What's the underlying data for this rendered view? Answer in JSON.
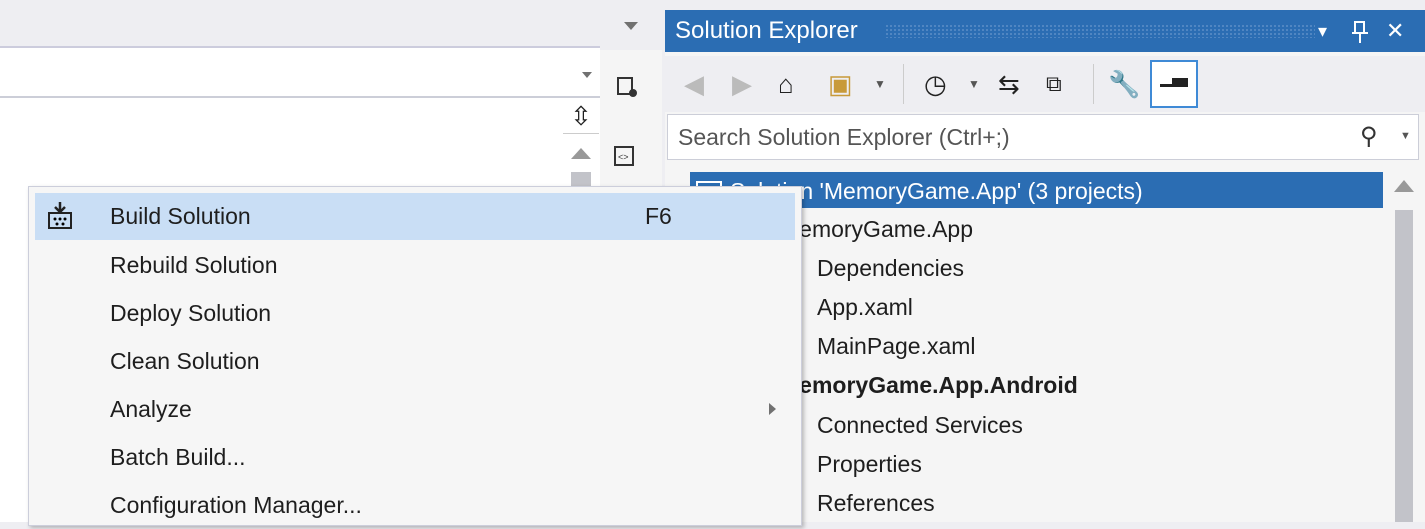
{
  "solution_explorer": {
    "title": "Solution Explorer",
    "search_placeholder": "Search Solution Explorer (Ctrl+;)",
    "toolbar_icons": [
      "back-icon",
      "forward-icon",
      "home-icon",
      "switch-views-icon",
      "pending-changes-filter-icon",
      "sync-icon",
      "collapse-all-icon",
      "properties-wrench-icon",
      "preview-selected-icon"
    ],
    "tree": [
      {
        "label": "Solution 'MemoryGame.App' (3 projects)",
        "selected": true
      },
      {
        "label": "MemoryGame.App"
      },
      {
        "label": "Dependencies"
      },
      {
        "label": "App.xaml"
      },
      {
        "label": "MainPage.xaml"
      },
      {
        "label": "MemoryGame.App.Android",
        "bold": true
      },
      {
        "label": "Connected Services"
      },
      {
        "label": "Properties"
      },
      {
        "label": "References"
      }
    ],
    "accent": "#2b6db3"
  },
  "menu": {
    "items": [
      {
        "label": "Build Solution",
        "shortcut": "F6",
        "highlighted": true,
        "icon": "build-solution-icon"
      },
      {
        "label": "Rebuild Solution"
      },
      {
        "label": "Deploy Solution"
      },
      {
        "label": "Clean Solution"
      },
      {
        "label": "Analyze",
        "submenu": true
      },
      {
        "label": "Batch Build..."
      },
      {
        "label": "Configuration Manager..."
      }
    ],
    "highlight_color": "#c9def5"
  },
  "title_buttons": {
    "dropdown": "▾",
    "pin": "⊥",
    "close": "✕"
  }
}
